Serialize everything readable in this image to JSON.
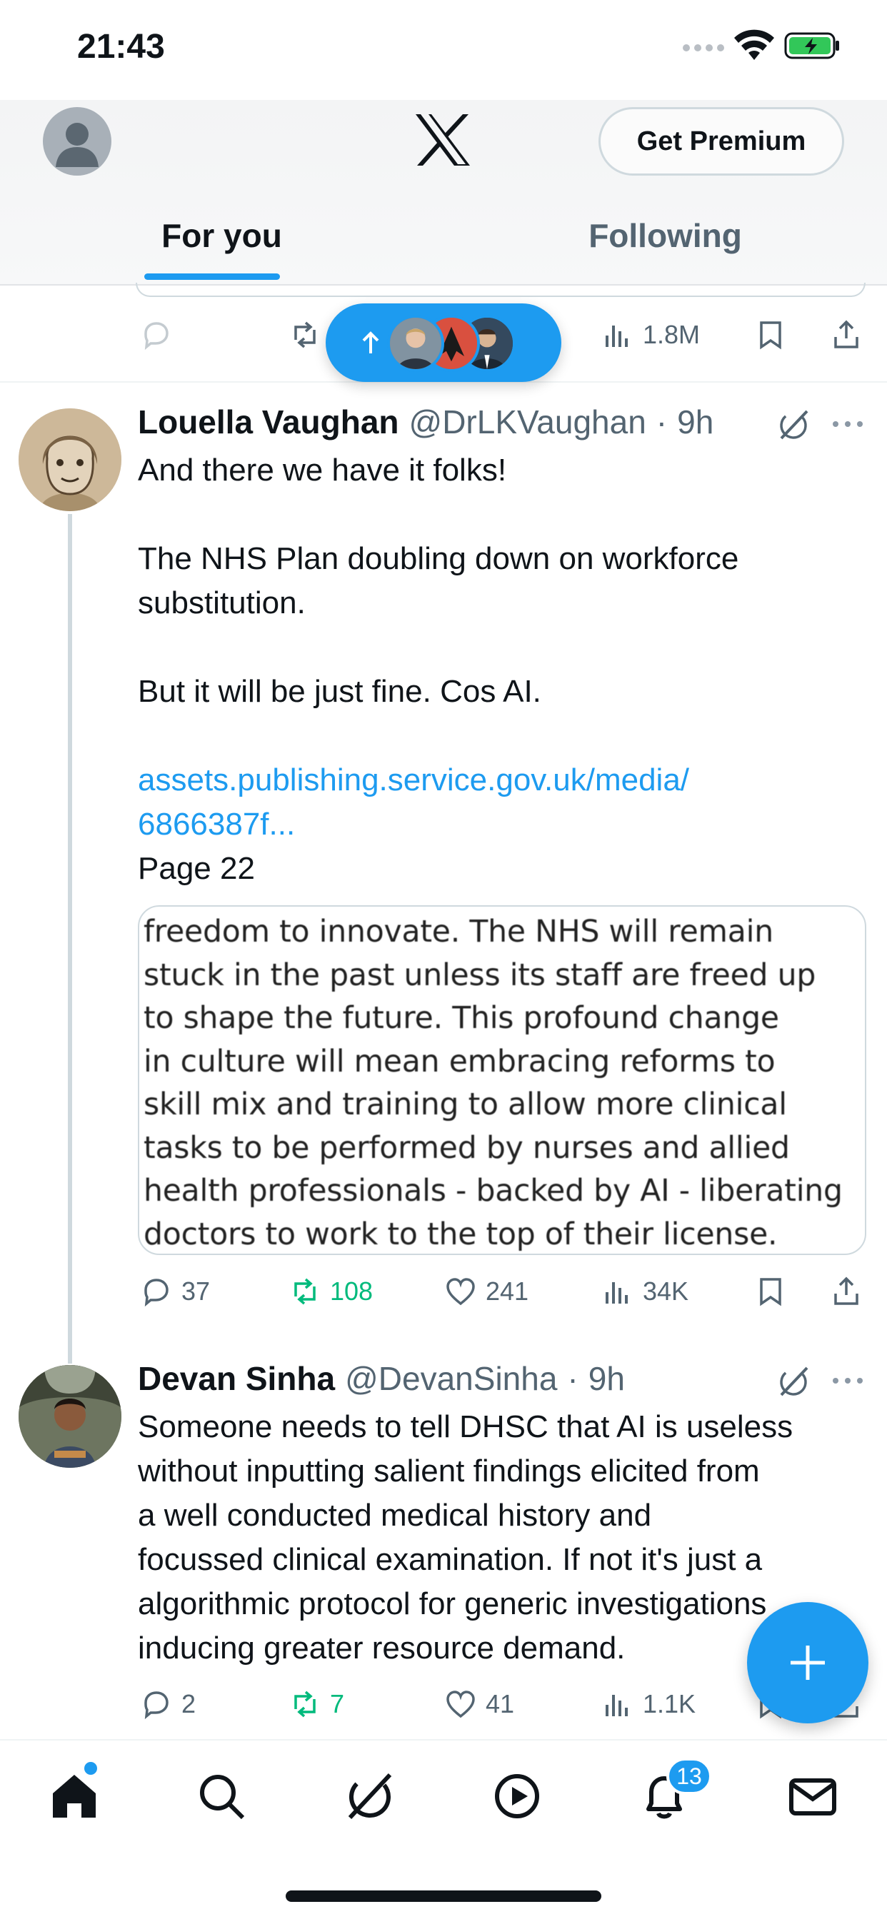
{
  "status_bar": {
    "time": "21:43"
  },
  "header": {
    "premium_label": "Get Premium",
    "logo": "x-logo"
  },
  "tabs": [
    {
      "label": "For you",
      "active": true
    },
    {
      "label": "Following",
      "active": false
    }
  ],
  "prev_tweet": {
    "views": "1.8M"
  },
  "new_posts_pill": {
    "arrow": "up-arrow-icon",
    "avatars": 3
  },
  "tweets": [
    {
      "name": "Louella Vaughan",
      "handle": "@DrLKVaughan",
      "separator": "·",
      "time": "9h",
      "text_lines": [
        "And there we have it folks!",
        "",
        "The NHS Plan doubling down on workforce",
        "substitution.",
        "",
        "But it will be just fine. Cos AI.",
        ""
      ],
      "link_line1": "assets.publishing.service.gov.uk/media/",
      "link_line2": "6866387f...",
      "after_link": "Page 22",
      "quote_image_lines": [
        "freedom to innovate. The NHS will remain",
        "stuck in the past unless its staff are freed up",
        "to shape the future. This profound change",
        "in culture will mean embracing reforms to",
        "skill mix and training to allow more clinical",
        "tasks to be performed by nurses and allied",
        "health professionals - backed by AI - liberating",
        "doctors to work to the top of their license."
      ],
      "replies": "37",
      "reposts": "108",
      "likes": "241",
      "views": "34K"
    },
    {
      "name": "Devan Sinha",
      "handle": "@DevanSinha",
      "separator": "·",
      "time": "9h",
      "text_lines": [
        "Someone needs to tell DHSC that AI is useless",
        "without inputting salient findings elicited from",
        "a well conducted medical history and",
        "focussed clinical examination. If not it's just a",
        "algorithmic protocol for generic investigations",
        "inducing greater resource demand."
      ],
      "replies": "2",
      "reposts": "7",
      "likes": "41",
      "views": "1.1K"
    }
  ],
  "bottom_nav": {
    "items": [
      "home-icon",
      "search-icon",
      "grok-icon",
      "video-icon",
      "notifications-icon",
      "messages-icon"
    ],
    "notification_count": "13"
  },
  "colors": {
    "accent": "#1d9bf0",
    "repost_green": "#00ba7c",
    "secondary_text": "#536471"
  }
}
